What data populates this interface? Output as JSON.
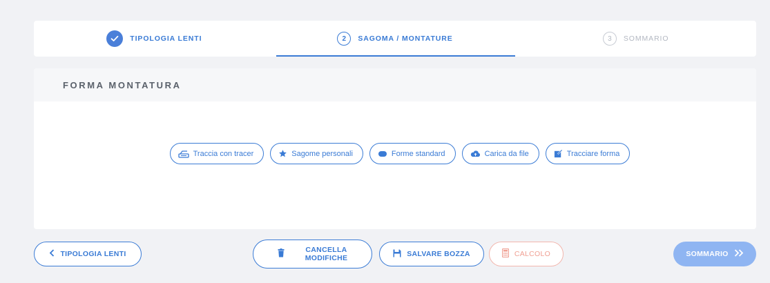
{
  "stepper": {
    "steps": [
      {
        "label": "TIPOLOGIA LENTI",
        "state": "done"
      },
      {
        "number": "2",
        "label": "SAGOMA / MONTATURE",
        "state": "active"
      },
      {
        "number": "3",
        "label": "SOMMARIO",
        "state": "todo"
      }
    ]
  },
  "panel": {
    "title": "FORMA MONTATURA",
    "options": [
      {
        "label": "Traccia con tracer",
        "icon": "tracer-icon"
      },
      {
        "label": "Sagome personali",
        "icon": "star-icon"
      },
      {
        "label": "Forme standard",
        "icon": "lens-shape-icon"
      },
      {
        "label": "Carica da file",
        "icon": "cloud-upload-icon"
      },
      {
        "label": "Tracciare forma",
        "icon": "edit-icon"
      }
    ]
  },
  "footer": {
    "back_label": "TIPOLOGIA LENTI",
    "cancel_label_line1": "CANCELLA",
    "cancel_label_line2": "MODIFICHE",
    "save_label": "SALVARE BOZZA",
    "calc_label": "CALCOLO",
    "summary_label": "SOMMARIO"
  },
  "colors": {
    "accent": "#3a7bd5",
    "calc": "#f0a093",
    "summary_bg": "#8fb5f2",
    "background": "#f1f2f5"
  }
}
